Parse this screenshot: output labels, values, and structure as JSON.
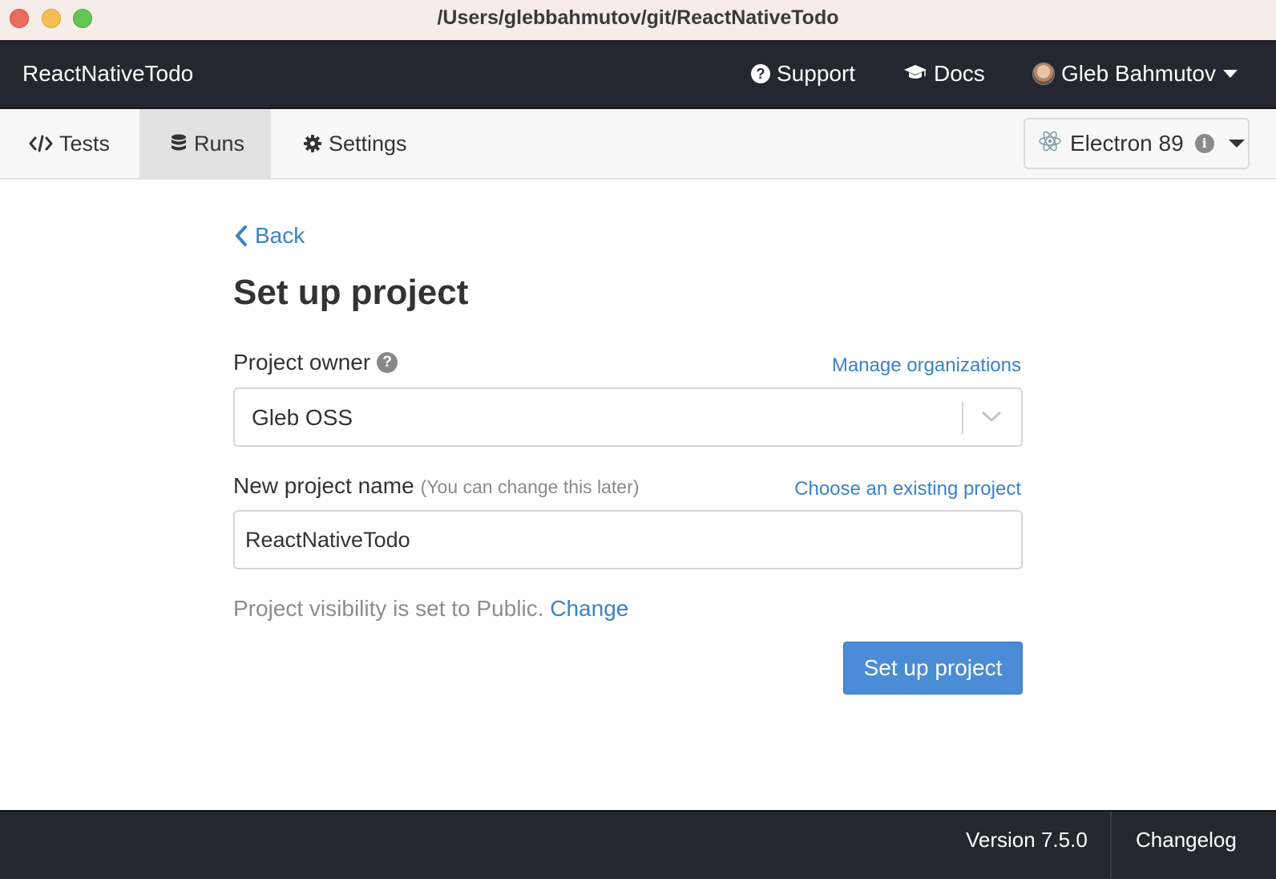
{
  "window": {
    "title": "/Users/glebbahmutov/git/ReactNativeTodo"
  },
  "header": {
    "project_name": "ReactNativeTodo",
    "support_label": "Support",
    "docs_label": "Docs",
    "user_name": "Gleb Bahmutov"
  },
  "nav": {
    "tabs": [
      {
        "label": "Tests",
        "icon": "code-icon",
        "active": false
      },
      {
        "label": "Runs",
        "icon": "database-icon",
        "active": true
      },
      {
        "label": "Settings",
        "icon": "gear-icon",
        "active": false
      }
    ],
    "browser": {
      "label": "Electron 89",
      "icon": "electron-icon"
    }
  },
  "main": {
    "back_label": "Back",
    "title": "Set up project",
    "owner_label": "Project owner",
    "manage_orgs_label": "Manage organizations",
    "owner_value": "Gleb OSS",
    "name_label": "New project name",
    "name_hint": "(You can change this later)",
    "choose_existing_label": "Choose an existing project",
    "name_value": "ReactNativeTodo",
    "visibility_text": "Project visibility is set to Public.",
    "visibility_change": "Change",
    "submit_label": "Set up project"
  },
  "footer": {
    "version": "Version 7.5.0",
    "changelog": "Changelog"
  },
  "colors": {
    "accent": "#4a8cd6",
    "link": "#3a82c8",
    "header_bg": "#23272f",
    "nav_bg": "#f8f8f8",
    "active_tab_bg": "#e2e2e2"
  }
}
